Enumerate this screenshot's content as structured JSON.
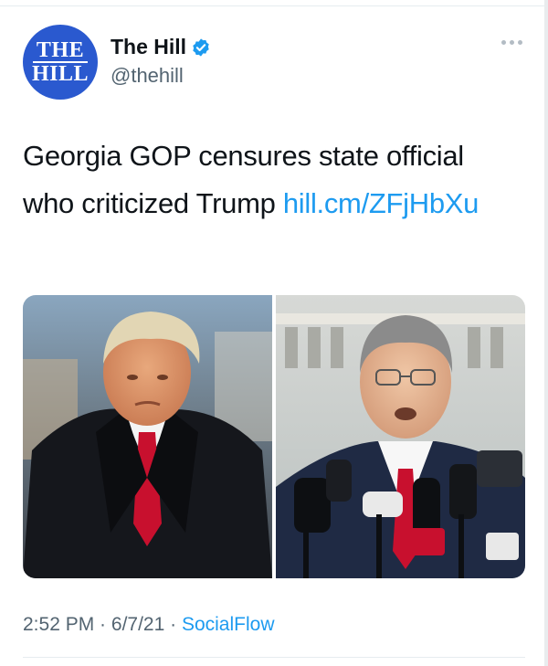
{
  "account": {
    "avatar_text": [
      "THE",
      "HILL"
    ],
    "display_name": "The Hill",
    "handle": "@thehill",
    "verified": true
  },
  "tweet": {
    "text": "Georgia GOP censures state official who criticized Trump ",
    "link": "hill.cm/ZFjHbXu"
  },
  "media": [
    {
      "kind": "photo",
      "subject": "man-in-dark-coat-red-tie"
    },
    {
      "kind": "photo",
      "subject": "man-speaking-at-press-microphones"
    }
  ],
  "meta": {
    "time": "2:52 PM",
    "date": "6/7/21",
    "separator": " · ",
    "source": "SocialFlow"
  },
  "icons": {
    "verified": "verified-badge-icon",
    "more": "more-options-icon"
  },
  "colors": {
    "link": "#1d9bf0",
    "avatar_bg": "#2a59cf",
    "secondary_text": "#536471"
  }
}
